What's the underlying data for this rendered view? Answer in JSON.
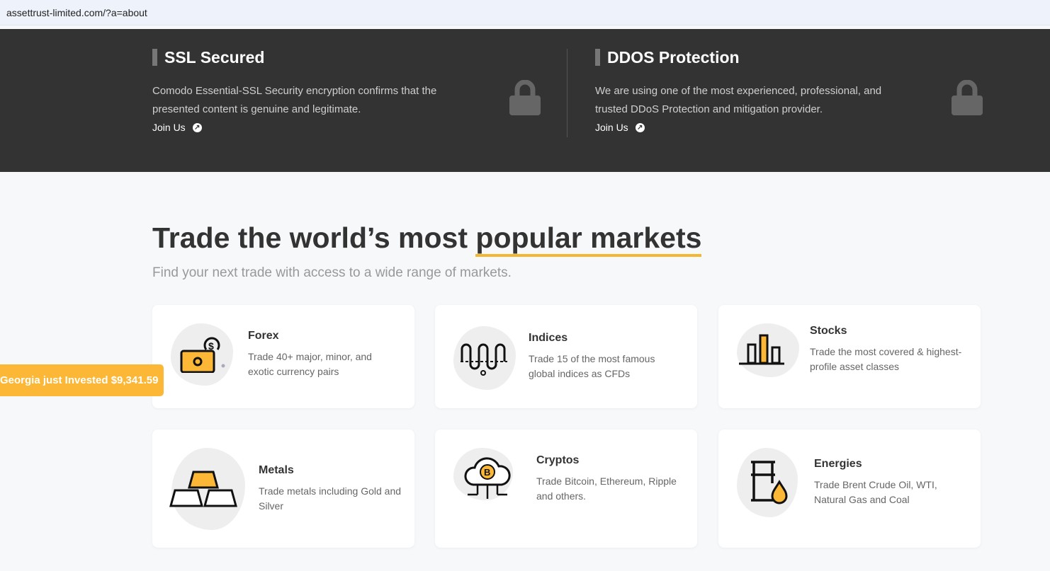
{
  "browser": {
    "url": "assettrust-limited.com/?a=about"
  },
  "features": [
    {
      "title": "SSL Secured",
      "text": "Comodo Essential-SSL Security encryption confirms that the presented content is genuine and legitimate.",
      "link": "Join Us"
    },
    {
      "title": "DDOS Protection",
      "text": "We are using one of the most experienced, professional, and trusted DDoS Protection and mitigation provider.",
      "link": "Join Us"
    }
  ],
  "markets": {
    "title_plain": "Trade the world’s most ",
    "title_highlight": "popular markets",
    "subtitle": "Find your next trade with access to a wide range of markets.",
    "cards": [
      {
        "name": "Forex",
        "desc": "Trade 40+ major, minor, and exotic currency pairs"
      },
      {
        "name": "Indices",
        "desc": "Trade 15 of the most famous global indices as CFDs"
      },
      {
        "name": "Stocks",
        "desc": "Trade the most covered & highest-profile asset classes"
      },
      {
        "name": "Metals",
        "desc": "Trade metals including Gold and Silver"
      },
      {
        "name": "Cryptos",
        "desc": "Trade Bitcoin, Ethereum, Ripple and others."
      },
      {
        "name": "Energies",
        "desc": "Trade Brent Crude Oil, WTI, Natural Gas and Coal"
      }
    ]
  },
  "toast": {
    "text": "Georgia just Invested $9,341.59"
  },
  "colors": {
    "accent": "#fbb735",
    "dark": "#333333"
  }
}
